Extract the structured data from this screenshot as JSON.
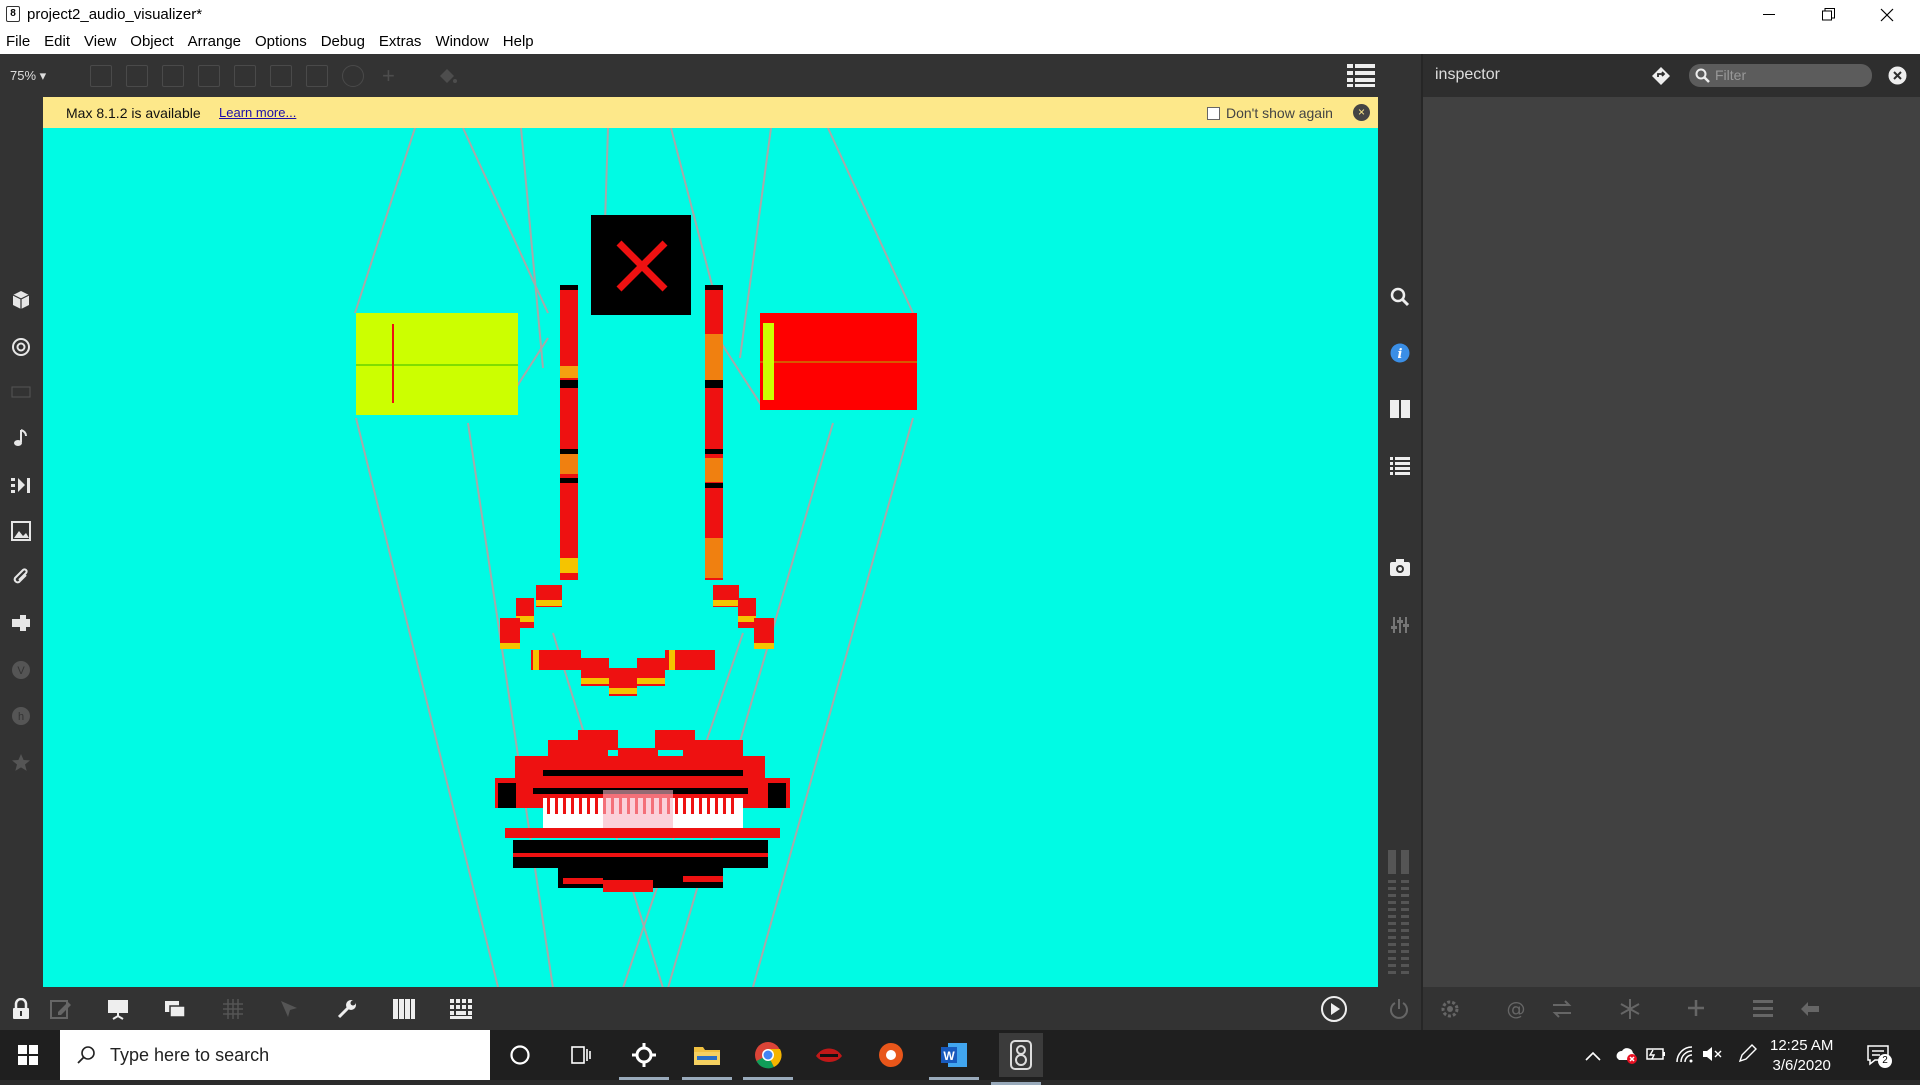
{
  "window": {
    "title": "project2_audio_visualizer*",
    "app_icon": "8"
  },
  "menu": [
    "File",
    "Edit",
    "View",
    "Object",
    "Arrange",
    "Options",
    "Debug",
    "Extras",
    "Window",
    "Help"
  ],
  "toolbar": {
    "zoom": "75% ▾"
  },
  "notification": {
    "message": "Max 8.1.2 is available",
    "link": "Learn more...",
    "checkbox_label": "Don't show again",
    "close": "×"
  },
  "inspector": {
    "title": "inspector",
    "filter_placeholder": "Filter"
  },
  "taskbar": {
    "search_placeholder": "Type here to search",
    "time": "12:25 AM",
    "date": "3/6/2020",
    "notifications_count": "2"
  },
  "colors": {
    "canvas": "#00fbe4",
    "yellow_panel": "#ccff00",
    "red_panel": "#ff0000",
    "accent_red": "#ee1111",
    "orange": "#f08010",
    "yellow_block": "#f5c400"
  },
  "icons": {
    "left_sidebar": [
      "cube-icon",
      "target-icon",
      "keyboard-icon",
      "music-note-icon",
      "sequence-icon",
      "image-icon",
      "paperclip-icon",
      "plugin-icon",
      "vst-icon",
      "help-icon",
      "star-icon"
    ],
    "right_strip": [
      "search-icon",
      "info-icon",
      "columns-icon",
      "list-icon",
      "camera-icon",
      "mixer-icon"
    ],
    "bottom_left": [
      "lock-icon",
      "edit-icon",
      "presentation-icon",
      "layers-icon",
      "grid-icon",
      "pointer-icon",
      "wrench-icon",
      "piano-icon",
      "keypad-icon"
    ],
    "bottom_right": [
      "play-icon",
      "power-icon",
      "gear-icon",
      "at-icon",
      "swap-icon",
      "snowflake-icon",
      "plus-icon",
      "menu-icon",
      "back-icon"
    ]
  }
}
